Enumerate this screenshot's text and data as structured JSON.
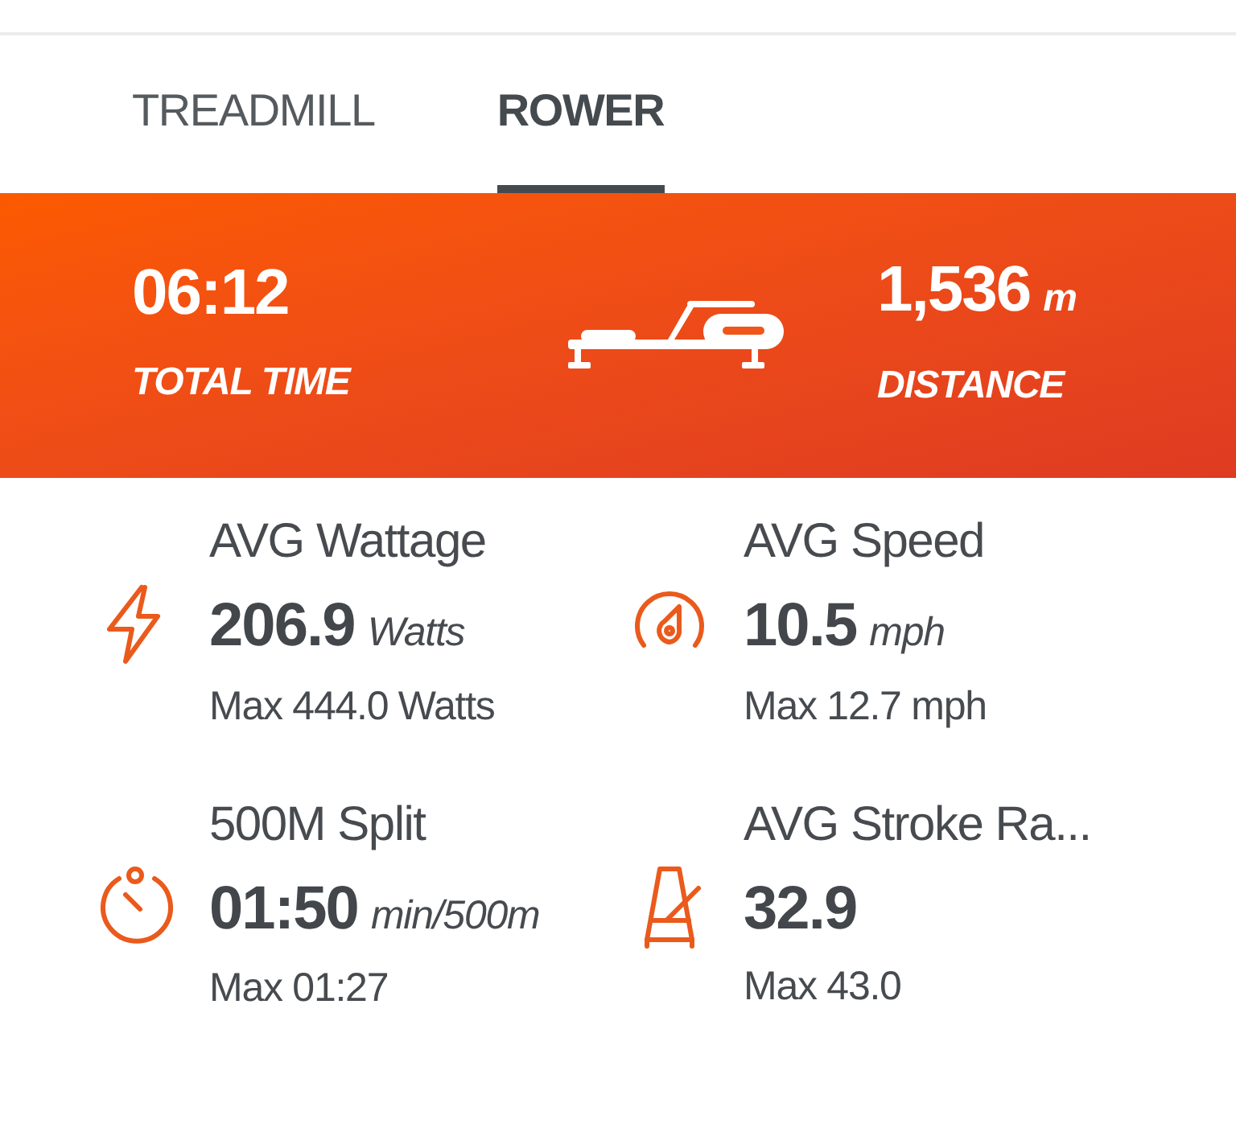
{
  "tabs": [
    {
      "label": "TREADMILL",
      "selected": false
    },
    {
      "label": "ROWER",
      "selected": true
    }
  ],
  "summary": {
    "left": {
      "value": "06:12",
      "label": "TOTAL TIME"
    },
    "right": {
      "value": "1,536",
      "unit": "m",
      "label": "DISTANCE"
    }
  },
  "metrics": [
    {
      "kind": "power",
      "title": "AVG Wattage",
      "value": "206.9",
      "unit": "Watts",
      "max": "Max 444.0 Watts"
    },
    {
      "kind": "speed",
      "title": "AVG Speed",
      "value": "10.5",
      "unit": "mph",
      "max": "Max 12.7 mph"
    },
    {
      "kind": "timer",
      "title": "500M Split",
      "value": "01:50",
      "unit": "min/500m",
      "max": "Max 01:27"
    },
    {
      "kind": "metronome",
      "title": "AVG Stroke Ra...",
      "value": "32.9",
      "max": "Max 43.0"
    }
  ]
}
